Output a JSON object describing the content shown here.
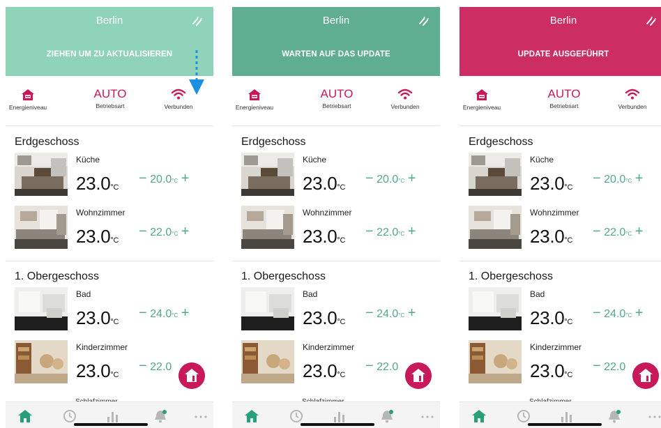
{
  "colors": {
    "header_green_light": "#8fd3b9",
    "header_green_dark": "#60ae92",
    "header_pink": "#cc2d62",
    "accent_pink": "#c8195b",
    "setpoint_green": "#52a88a",
    "tab_active": "#27a07a",
    "tab_inactive": "#b6b6b6"
  },
  "screens": [
    {
      "city": "Berlin",
      "status": "ZIEHEN UM ZU AKTUALISIEREN",
      "header_color": "#8fd3b9",
      "show_arrow": true
    },
    {
      "city": "Berlin",
      "status": "WARTEN AUF DAS UPDATE",
      "header_color": "#60ae92",
      "show_arrow": false
    },
    {
      "city": "Berlin",
      "status": "UPDATE AUSGEFÜHRT",
      "header_color": "#cc2d62",
      "show_arrow": false
    }
  ],
  "summary": {
    "energy_label": "Energieniveau",
    "mode_value": "AUTO",
    "mode_label": "Betriebsart",
    "connection_label": "Verbunden"
  },
  "floors": [
    {
      "name": "Erdgeschoss",
      "rooms": [
        {
          "name": "Küche",
          "temp": "23.0",
          "unit": "°C",
          "setpoint": "20.0",
          "set_unit": "°C",
          "minus": "−",
          "plus": "+"
        },
        {
          "name": "Wohnzimmer",
          "temp": "23.0",
          "unit": "°C",
          "setpoint": "22.0",
          "set_unit": "°C",
          "minus": "−",
          "plus": "+"
        }
      ]
    },
    {
      "name": "1. Obergeschoss",
      "rooms": [
        {
          "name": "Bad",
          "temp": "23.0",
          "unit": "°C",
          "setpoint": "24.0",
          "set_unit": "°C",
          "minus": "−",
          "plus": "+"
        },
        {
          "name": "Kinderzimmer",
          "temp": "23.0",
          "unit": "°C",
          "setpoint": "22.0",
          "set_unit": "",
          "minus": "−",
          "plus": ""
        }
      ]
    }
  ],
  "partial_room_label": "Schlafzimmer",
  "icons": {
    "refresh": "refresh-icon",
    "energy": "house-energy-icon",
    "connection": "wifi-icon",
    "fab": "house-info-icon",
    "tabs": [
      "home-icon",
      "schedule-icon",
      "statistics-icon",
      "notifications-icon",
      "more-icon"
    ]
  }
}
